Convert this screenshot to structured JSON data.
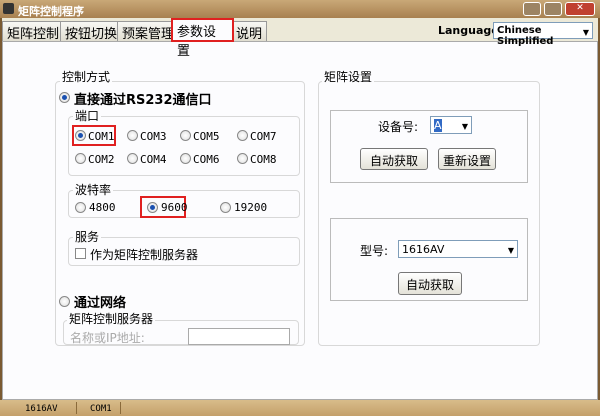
{
  "window": {
    "title": "矩阵控制程序",
    "minimize": "–",
    "maximize": "□",
    "close": "✕"
  },
  "tabs": [
    {
      "label": "矩阵控制"
    },
    {
      "label": "按钮切换"
    },
    {
      "label": "预案管理"
    },
    {
      "label": "参数设置",
      "active": true
    },
    {
      "label": "说明"
    }
  ],
  "language": {
    "label": "Language:",
    "value": "Chinese Simplified"
  },
  "control_mode": {
    "title": "控制方式",
    "direct": {
      "label": "直接通过RS232通信口",
      "selected": true
    },
    "port": {
      "title": "端口",
      "options": [
        "COM1",
        "COM3",
        "COM5",
        "COM7",
        "COM2",
        "COM4",
        "COM6",
        "COM8"
      ],
      "selected": "COM1"
    },
    "baud": {
      "title": "波特率",
      "options": [
        "4800",
        "9600",
        "19200"
      ],
      "selected": "9600"
    },
    "service": {
      "title": "服务",
      "checkbox_label": "作为矩阵控制服务器",
      "checked": false
    },
    "network": {
      "label": "通过网络",
      "selected": false
    },
    "server": {
      "title": "矩阵控制服务器",
      "field_label": "名称或IP地址:",
      "value": ""
    }
  },
  "matrix": {
    "title": "矩阵设置",
    "device_label": "设备号:",
    "device_value": "A",
    "auto_btn": "自动获取",
    "reset_btn": "重新设置",
    "model_label": "型号:",
    "model_value": "1616AV",
    "model_auto_btn": "自动获取"
  },
  "status": {
    "model": "1616AV",
    "port": "COM1"
  },
  "colors": {
    "highlight": "#e02020",
    "radio_selected": "#1a50b0"
  }
}
